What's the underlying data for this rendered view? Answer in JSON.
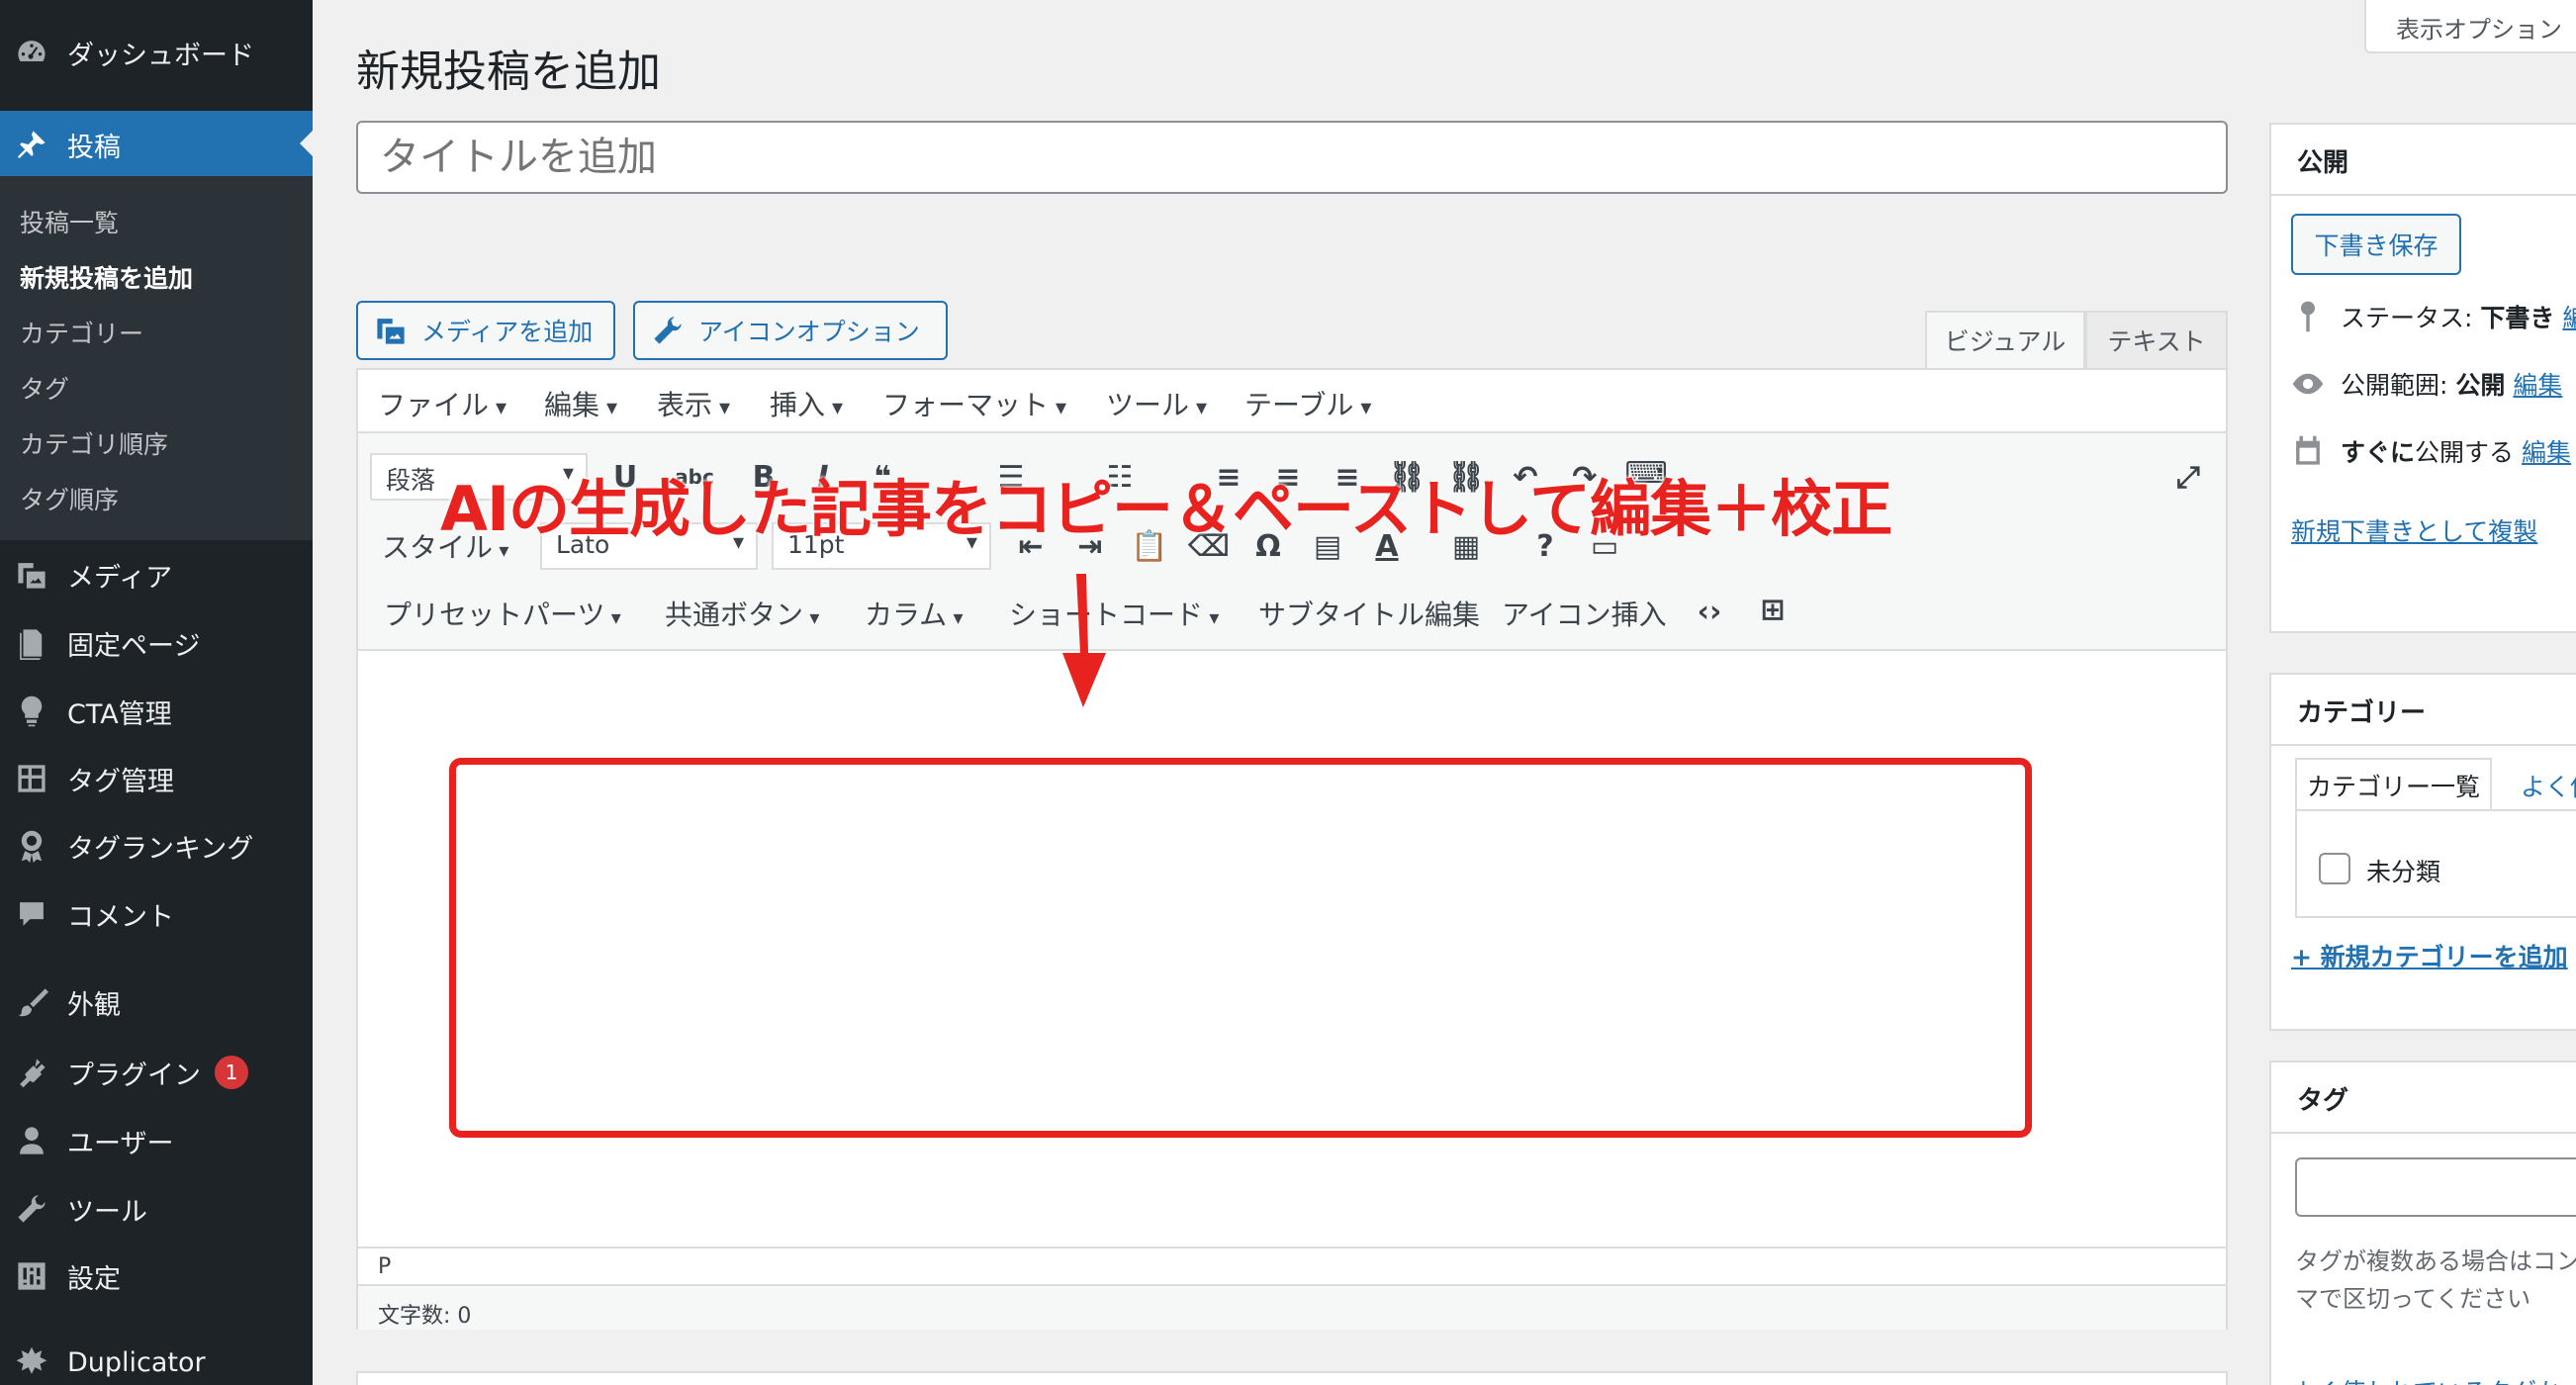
{
  "sidebar": {
    "dashboard": "ダッシュボード",
    "posts": "投稿",
    "submenu": [
      "投稿一覧",
      "新規投稿を追加",
      "カテゴリー",
      "タグ",
      "カテゴリ順序",
      "タグ順序"
    ],
    "media": "メディア",
    "pages": "固定ページ",
    "cta": "CTA管理",
    "tag_manage": "タグ管理",
    "tag_ranking": "タグランキング",
    "comments": "コメント",
    "appearance": "外観",
    "plugins": "プラグイン",
    "plugins_badge": "1",
    "users": "ユーザー",
    "tools": "ツール",
    "settings": "設定",
    "duplicator": "Duplicator"
  },
  "header": {
    "page_title": "新規投稿を追加",
    "screen_options": "表示オプション"
  },
  "editor": {
    "title_placeholder": "タイトルを追加",
    "add_media": "メディアを追加",
    "icon_options": "アイコンオプション",
    "tab_visual": "ビジュアル",
    "tab_text": "テキスト",
    "menubar": [
      "ファイル",
      "編集",
      "表示",
      "挿入",
      "フォーマット",
      "ツール",
      "テーブル"
    ],
    "format_select": "段落",
    "style_label": "スタイル",
    "font_select": "Lato",
    "size_select": "11pt",
    "row3": [
      "プリセットパーツ",
      "共通ボタン",
      "カラム",
      "ショートコード"
    ],
    "subtitle_edit": "サブタイトル編集",
    "icon_insert": "アイコン挿入",
    "status_path": "P",
    "word_count": "文字数: 0"
  },
  "annotation": {
    "text": "AIの生成した記事をコピー＆ペーストして編集＋校正",
    "color": "#e8231f"
  },
  "publish": {
    "title": "公開",
    "save_draft": "下書き保存",
    "status_label": "ステータス:",
    "status_value": "下書き",
    "status_link": "編",
    "visibility_label": "公開範囲:",
    "visibility_value": "公開",
    "visibility_link": "編集",
    "schedule_value": "すぐに",
    "schedule_suffix": "公開する",
    "schedule_link": "編集",
    "duplicate_link": "新規下書きとして複製"
  },
  "category": {
    "title": "カテゴリー",
    "tab_all": "カテゴリー一覧",
    "tab_popular": "よく使",
    "item": "未分類",
    "add_link": "+ 新規カテゴリーを追加"
  },
  "tags": {
    "title": "タグ",
    "hint": "タグが複数ある場合はコンマで区切ってください",
    "hint_visible": "タグが複数ある場合はコ ださい",
    "popular_link": "よく使われているタグか"
  },
  "colors": {
    "sidebar_bg": "#1d2327",
    "accent": "#2271b1",
    "badge": "#d63638"
  }
}
